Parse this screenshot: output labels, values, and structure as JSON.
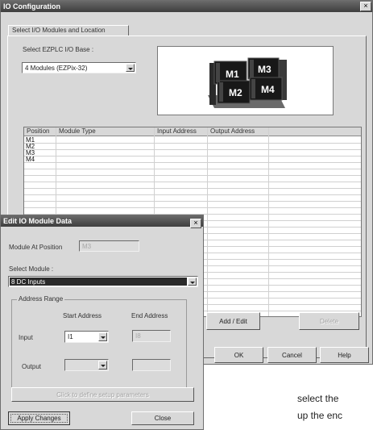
{
  "io_config": {
    "title": "IO Configuration",
    "tab_label": "Select I/O Modules and Location",
    "base_label": "Select EZPLC I/O Base :",
    "base_value": "4 Modules (EZPix-32)",
    "module_slots": [
      "M1",
      "M3",
      "M2",
      "M4"
    ],
    "grid": {
      "headers": [
        "Position",
        "Module Type",
        "Input Address",
        "Output Address"
      ],
      "rows": [
        {
          "position": "M1"
        },
        {
          "position": "M2"
        },
        {
          "position": "M3"
        },
        {
          "position": "M4"
        }
      ]
    },
    "add_edit_label": "Add / Edit",
    "delete_label": "Delete",
    "ok_label": "OK",
    "cancel_label": "Cancel",
    "help_label": "Help"
  },
  "edit_dialog": {
    "title": "Edit IO Module Data",
    "position_label": "Module At Position",
    "position_value": "M3",
    "select_module_label": "Select Module :",
    "select_module_value": "8 DC Inputs",
    "address_range_label": "Address Range",
    "start_address_label": "Start Address",
    "end_address_label": "End Address",
    "input_label": "Input",
    "input_start": "I1",
    "input_end": "I8",
    "output_label": "Output",
    "setup_button_label": "Click to define setup parameters",
    "apply_label": "Apply Changes",
    "close_label": "Close"
  },
  "body_text": {
    "line1": "select the",
    "line2": "up the enc"
  },
  "colors": {
    "dialog_bg": "#d8d8d8",
    "titlebar": "#4a4a4a",
    "selection": "#2a2a2a"
  }
}
